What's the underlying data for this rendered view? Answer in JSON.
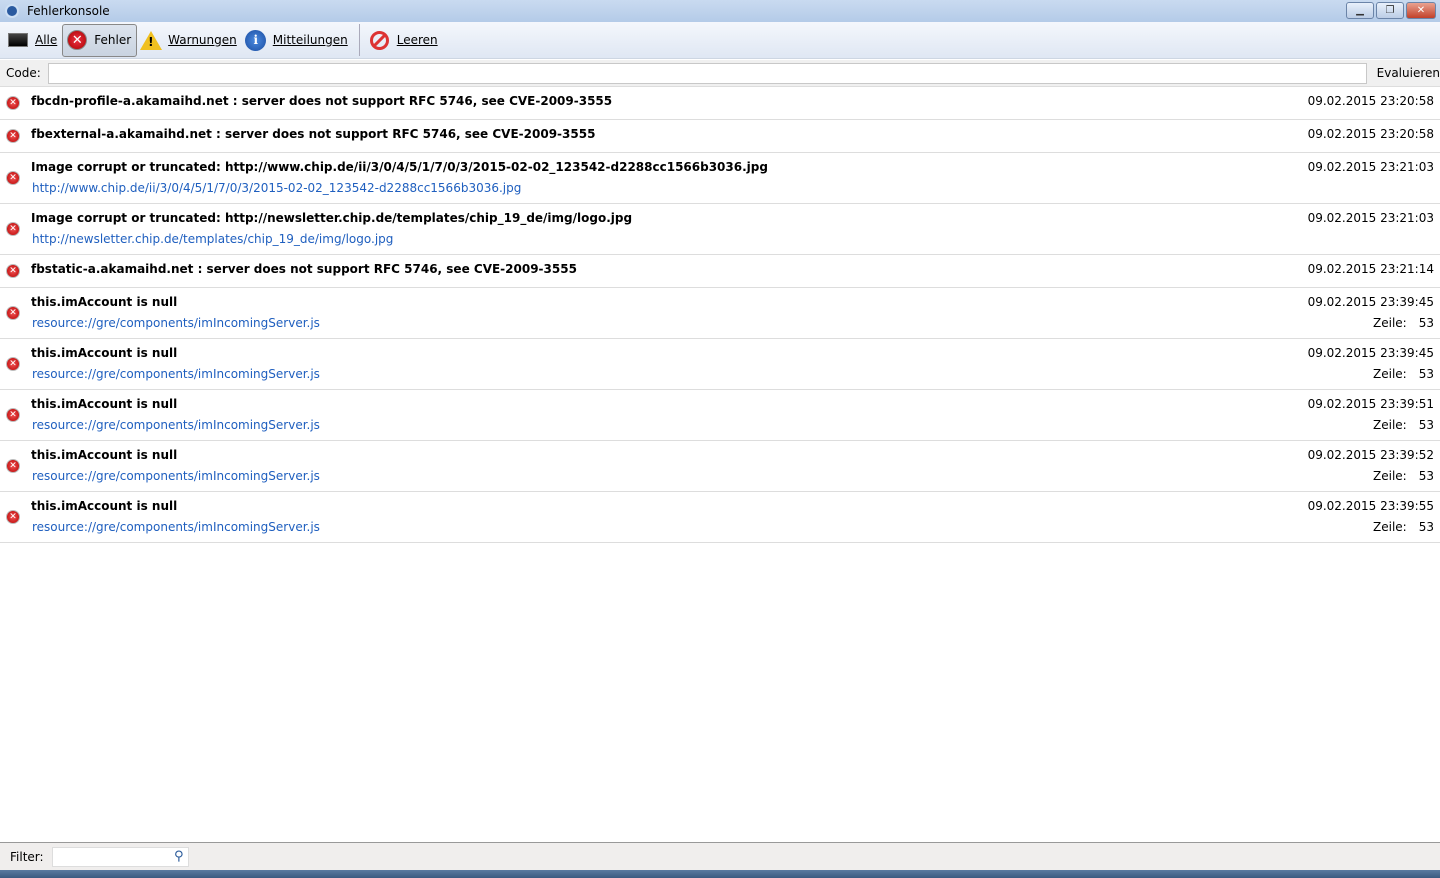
{
  "window": {
    "title": "Fehlerkonsole"
  },
  "toolbar": {
    "all": "Alle",
    "errors": "Fehler",
    "warnings": "Warnungen",
    "messages": "Mitteilungen",
    "clear": "Leeren"
  },
  "code": {
    "label": "Code:",
    "value": "",
    "evaluate": "Evaluieren"
  },
  "entries": [
    {
      "message": "fbcdn-profile-a.akamaihd.net : server does not support RFC 5746, see CVE-2009-3555",
      "time": "09.02.2015 23:20:58"
    },
    {
      "message": "fbexternal-a.akamaihd.net : server does not support RFC 5746, see CVE-2009-3555",
      "time": "09.02.2015 23:20:58"
    },
    {
      "message": "Image corrupt or truncated: http://www.chip.de/ii/3/0/4/5/1/7/0/3/2015-02-02_123542-d2288cc1566b3036.jpg",
      "source": "http://www.chip.de/ii/3/0/4/5/1/7/0/3/2015-02-02_123542-d2288cc1566b3036.jpg",
      "time": "09.02.2015 23:21:03"
    },
    {
      "message": "Image corrupt or truncated: http://newsletter.chip.de/templates/chip_19_de/img/logo.jpg",
      "source": "http://newsletter.chip.de/templates/chip_19_de/img/logo.jpg",
      "time": "09.02.2015 23:21:03"
    },
    {
      "message": "fbstatic-a.akamaihd.net : server does not support RFC 5746, see CVE-2009-3555",
      "time": "09.02.2015 23:21:14"
    },
    {
      "message": "this.imAccount is null",
      "source": "resource://gre/components/imIncomingServer.js",
      "time": "09.02.2015 23:39:45",
      "line_label": "Zeile:",
      "line": "53"
    },
    {
      "message": "this.imAccount is null",
      "source": "resource://gre/components/imIncomingServer.js",
      "time": "09.02.2015 23:39:45",
      "line_label": "Zeile:",
      "line": "53"
    },
    {
      "message": "this.imAccount is null",
      "source": "resource://gre/components/imIncomingServer.js",
      "time": "09.02.2015 23:39:51",
      "line_label": "Zeile:",
      "line": "53"
    },
    {
      "message": "this.imAccount is null",
      "source": "resource://gre/components/imIncomingServer.js",
      "time": "09.02.2015 23:39:52",
      "line_label": "Zeile:",
      "line": "53"
    },
    {
      "message": "this.imAccount is null",
      "source": "resource://gre/components/imIncomingServer.js",
      "time": "09.02.2015 23:39:55",
      "line_label": "Zeile:",
      "line": "53"
    }
  ],
  "filter": {
    "label": "Filter:",
    "value": ""
  }
}
